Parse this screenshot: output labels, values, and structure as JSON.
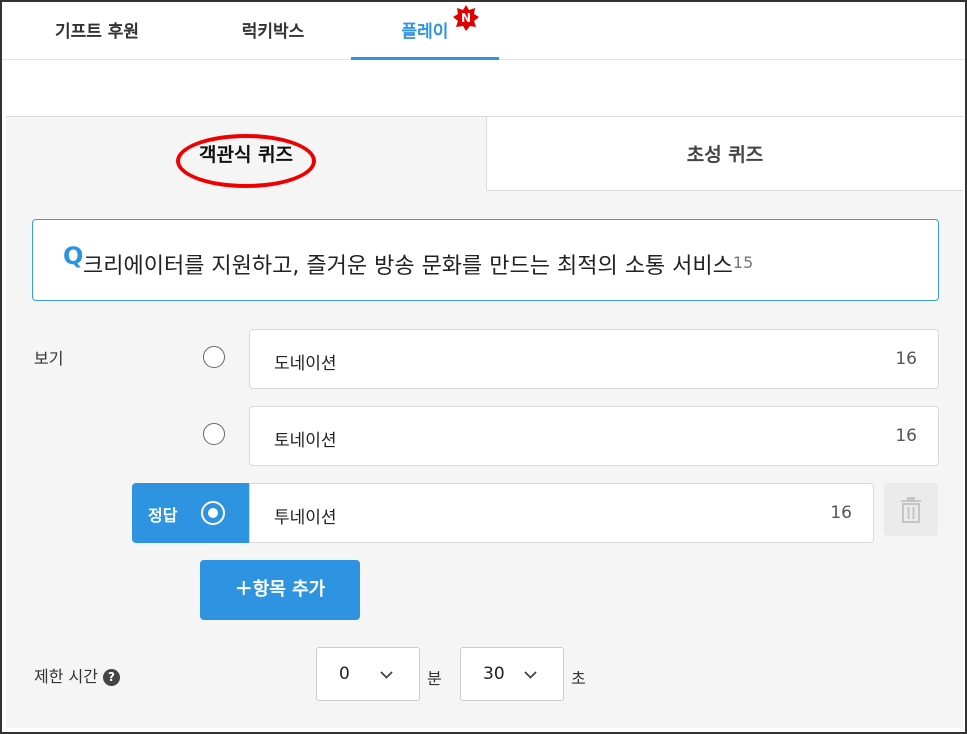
{
  "top_tabs": [
    {
      "label": "기프트 후원"
    },
    {
      "label": "럭키박스"
    },
    {
      "label": "플레이"
    }
  ],
  "new_badge": "N",
  "quiz_tabs": {
    "multiple_choice": "객관식 퀴즈",
    "initial_consonant": "초성 퀴즈"
  },
  "question": {
    "mark": "Q",
    "text": "크리에이터를 지원하고, 즐거운 방송 문화를 만드는 최적의 소통 서비스",
    "char_count": "15"
  },
  "options_label": "보기",
  "options": [
    {
      "text": "도네이션",
      "count": "16",
      "selected": false
    },
    {
      "text": "토네이션",
      "count": "16",
      "selected": false
    },
    {
      "text": "투네이션",
      "count": "16",
      "selected": true
    }
  ],
  "answer_label": "정답",
  "add_button": "＋항목 추가",
  "time_limit": {
    "label": "제한 시간",
    "help": "?",
    "minutes": "0",
    "minutes_unit": "분",
    "seconds": "30",
    "seconds_unit": "초"
  },
  "colors": {
    "accent": "#2e93e0",
    "highlight_circle": "#e00000",
    "badge": "#e00000"
  }
}
